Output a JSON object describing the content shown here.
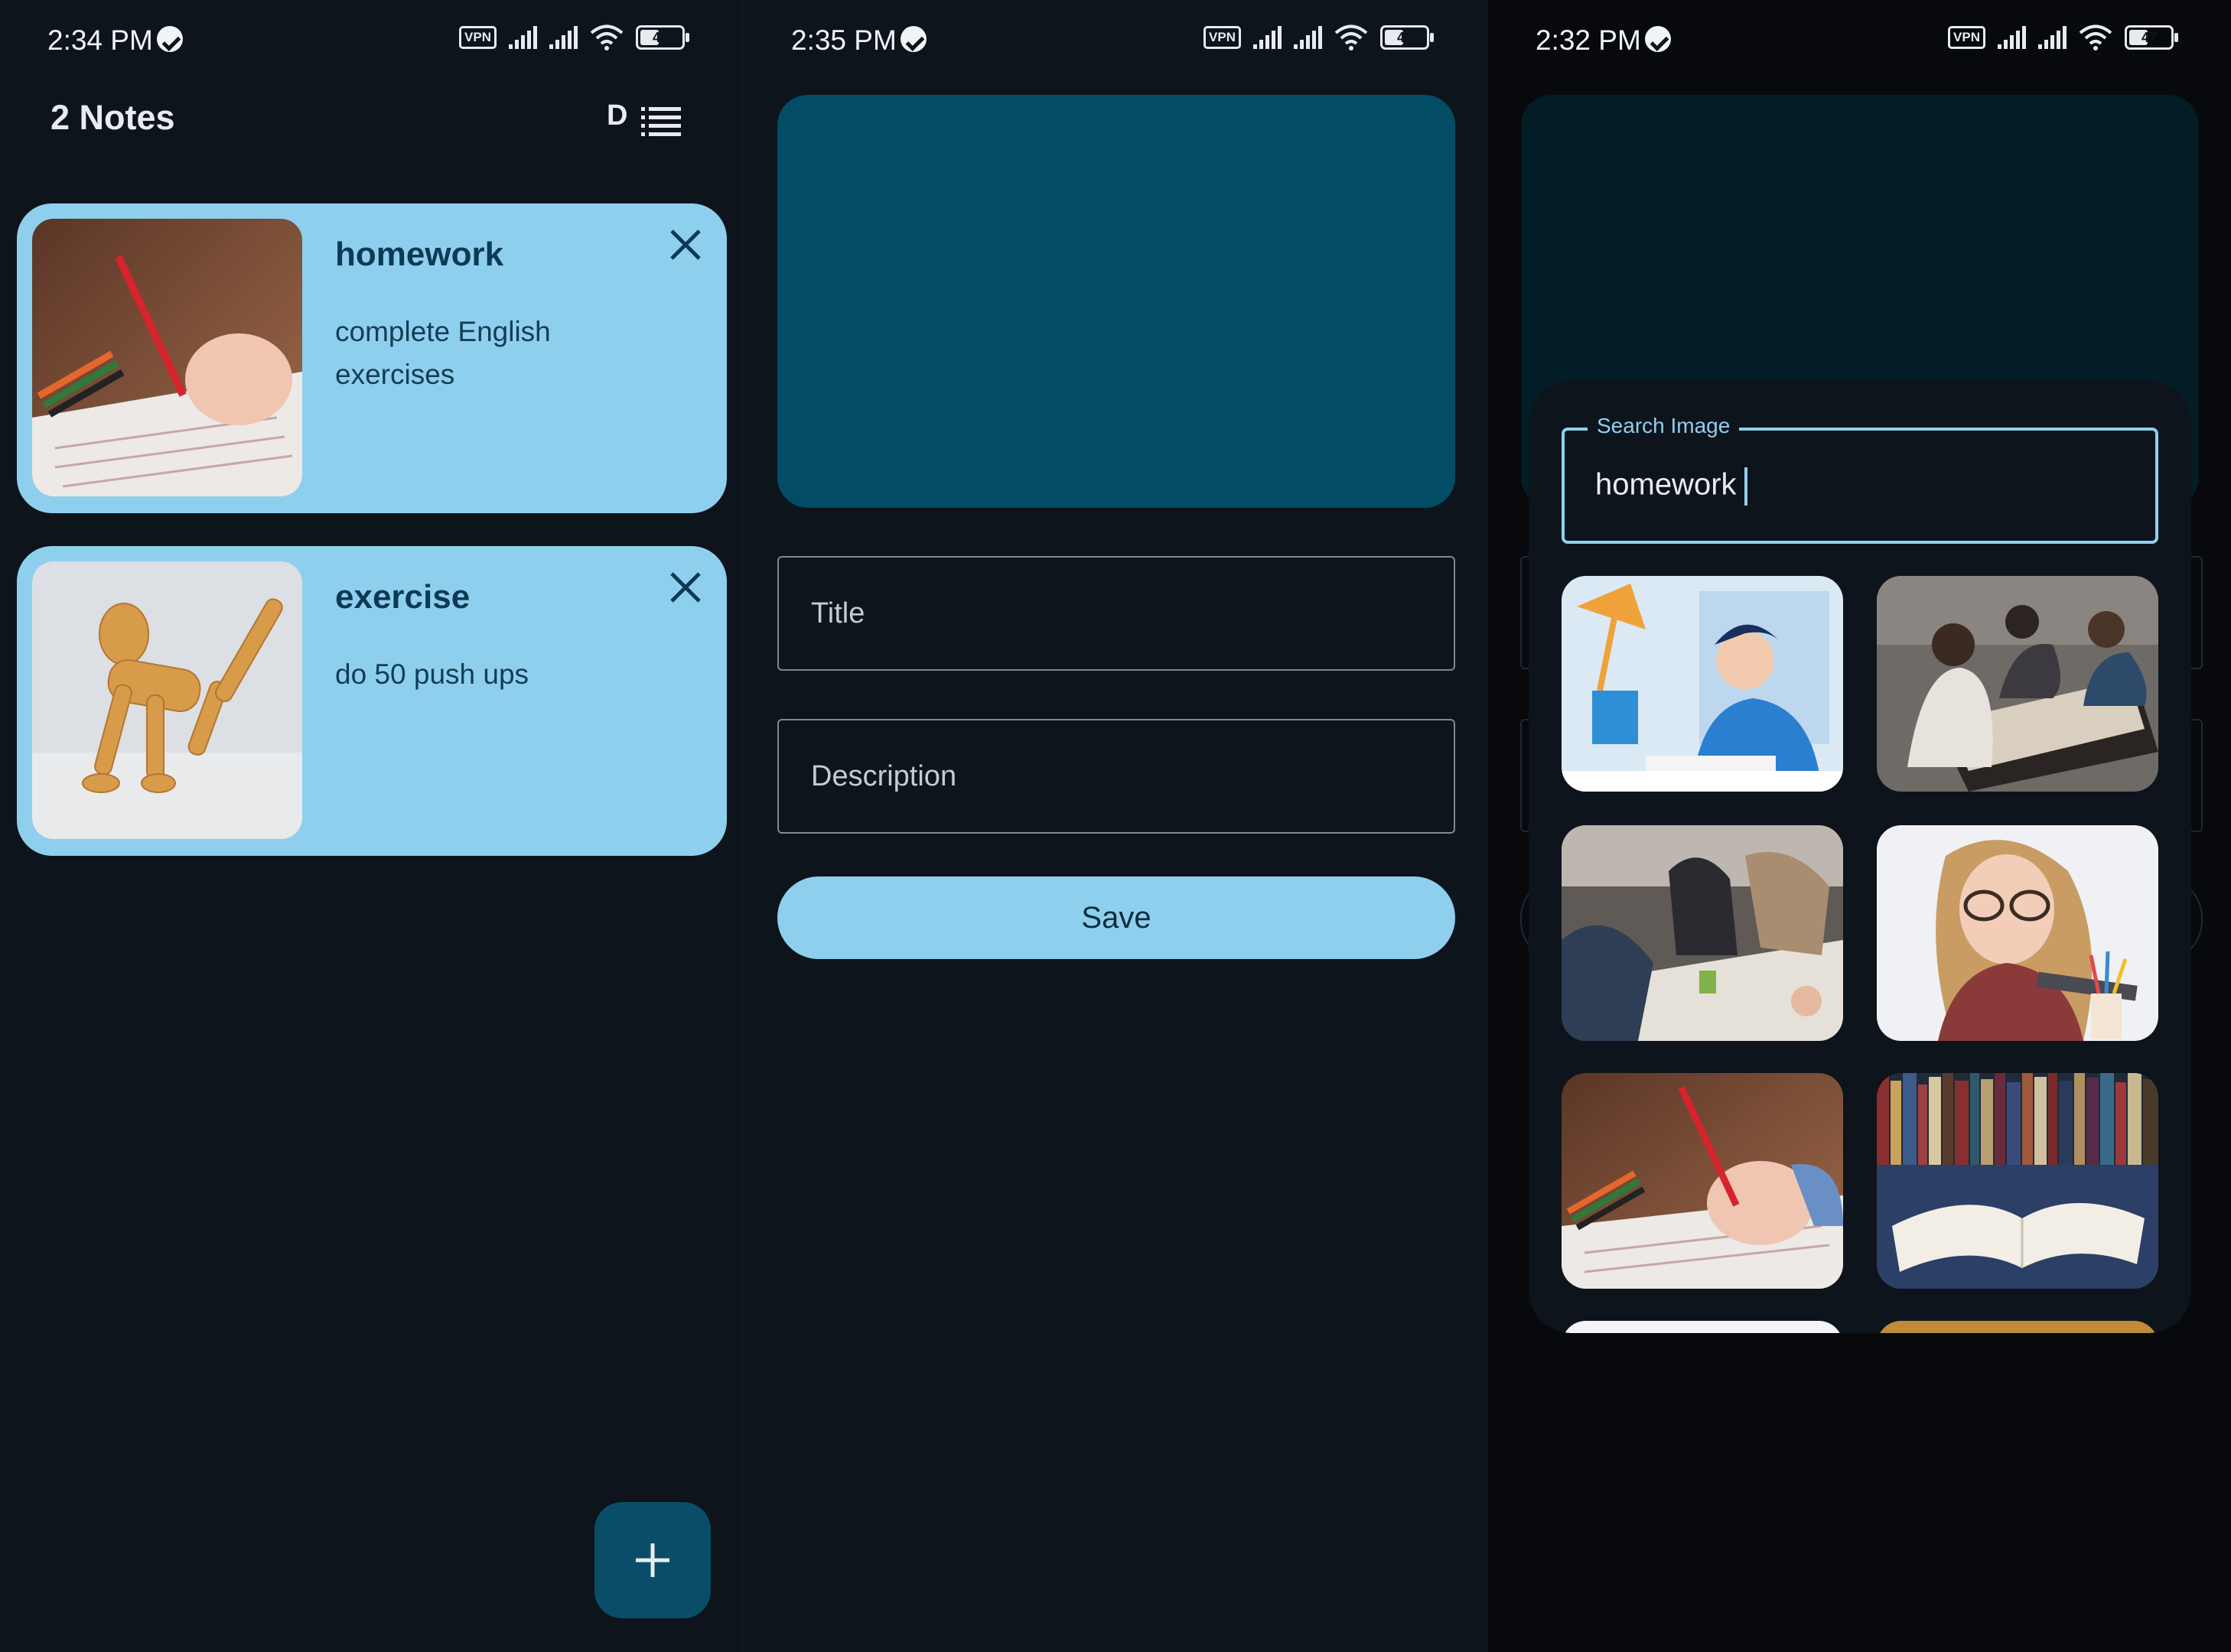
{
  "screens": [
    {
      "status": {
        "time": "2:34 PM",
        "vpn": "VPN",
        "battery": "47"
      },
      "header": {
        "title": "2 Notes",
        "sort_letter": "D"
      },
      "notes": [
        {
          "title": "homework",
          "description": "complete English exercises"
        },
        {
          "title": "exercise",
          "description": "do 50 push ups"
        }
      ],
      "fab_icon": "plus-icon"
    },
    {
      "status": {
        "time": "2:35 PM",
        "vpn": "VPN",
        "battery": "47"
      },
      "form": {
        "title_placeholder": "Title",
        "description_placeholder": "Description",
        "save_label": "Save"
      }
    },
    {
      "status": {
        "time": "2:32 PM",
        "vpn": "VPN",
        "battery": "47"
      },
      "search": {
        "label": "Search Image",
        "value": "homework"
      },
      "results": [
        "illustration-student-studying",
        "students-group-table",
        "students-on-floor",
        "girl-thinking-pencils",
        "hand-writing-worksheet",
        "open-book-library"
      ]
    }
  ],
  "colors": {
    "background": "#0e141b",
    "card": "#8fcfee",
    "card_text": "#0c3a54",
    "fab": "#0a4d69",
    "preview": "#024c66",
    "accent": "#8fcfee"
  }
}
